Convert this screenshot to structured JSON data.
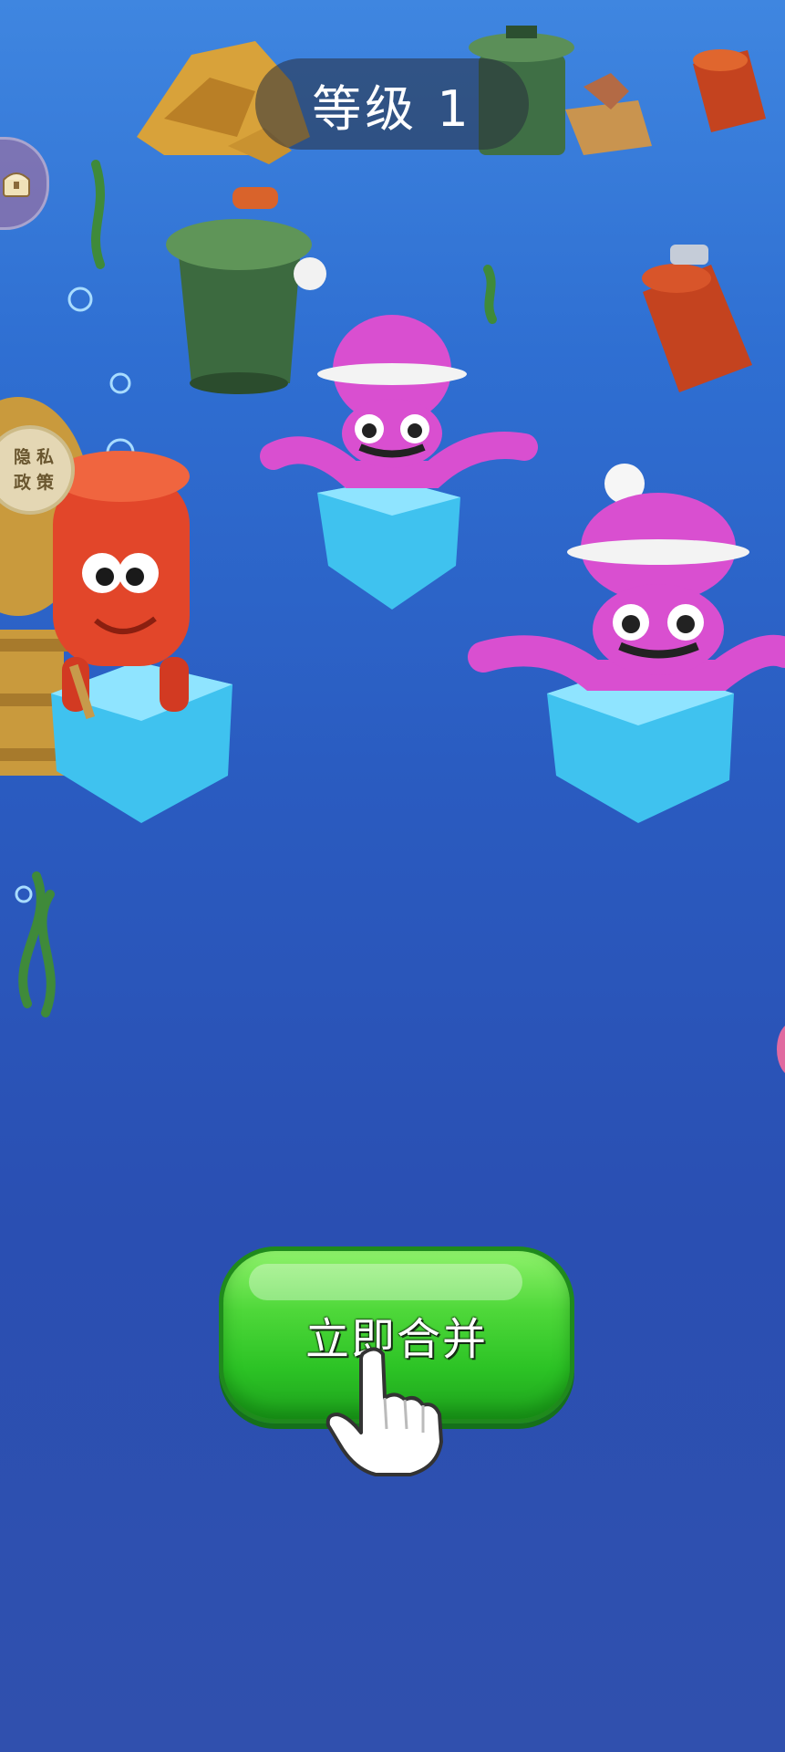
{
  "hud": {
    "level_label": "等级 1",
    "privacy_label": "隐私政策"
  },
  "action": {
    "merge_label": "立即合并"
  },
  "colors": {
    "water_top": "#3f86e0",
    "water_bottom": "#3050ae",
    "button_green": "#2cc325",
    "octopus_pink": "#d94fd0",
    "creature_red": "#e2462a",
    "platform_blue": "#3fc2ef"
  },
  "icons": {
    "top_side_button": "treasure-chest-icon",
    "pointer": "tap-hand-icon"
  }
}
